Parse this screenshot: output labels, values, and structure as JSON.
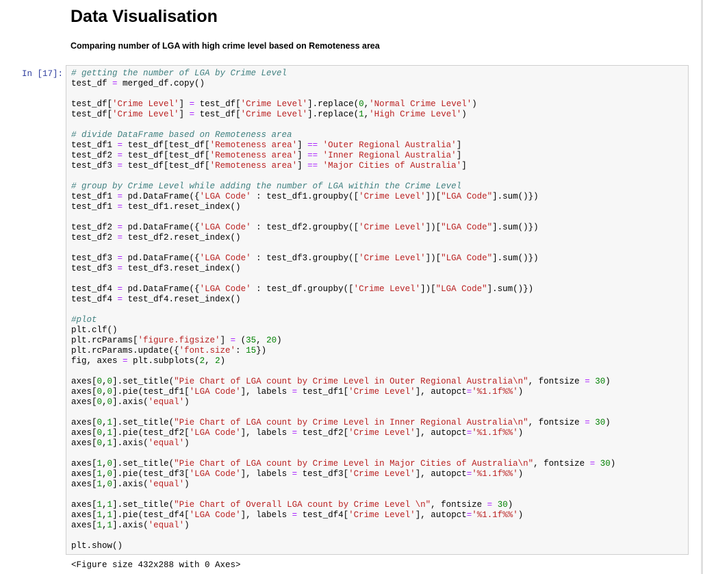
{
  "notebook": {
    "heading": "Data Visualisation",
    "subheading": "Comparing number of LGA with high crime level based on Remoteness area",
    "cell": {
      "prompt": "In [17]:",
      "output": "<Figure size 432x288 with 0 Axes>"
    }
  },
  "code_lines": [
    [
      [
        "cm",
        "# getting the number of LGA by Crime Level"
      ]
    ],
    [
      [
        "",
        "test_df "
      ],
      [
        "op",
        "="
      ],
      [
        "",
        " merged_df.copy()"
      ]
    ],
    [],
    [
      [
        "",
        "test_df["
      ],
      [
        "st",
        "'Crime Level'"
      ],
      [
        "",
        "] "
      ],
      [
        "op",
        "="
      ],
      [
        "",
        " test_df["
      ],
      [
        "st",
        "'Crime Level'"
      ],
      [
        "",
        "].replace("
      ],
      [
        "nu",
        "0"
      ],
      [
        "",
        ","
      ],
      [
        "st",
        "'Normal Crime Level'"
      ],
      [
        "",
        ")"
      ]
    ],
    [
      [
        "",
        "test_df["
      ],
      [
        "st",
        "'Crime Level'"
      ],
      [
        "",
        "] "
      ],
      [
        "op",
        "="
      ],
      [
        "",
        " test_df["
      ],
      [
        "st",
        "'Crime Level'"
      ],
      [
        "",
        "].replace("
      ],
      [
        "nu",
        "1"
      ],
      [
        "",
        ","
      ],
      [
        "st",
        "'High Crime Level'"
      ],
      [
        "",
        ")"
      ]
    ],
    [],
    [
      [
        "cm",
        "# divide DataFrame based on Remoteness area"
      ]
    ],
    [
      [
        "",
        "test_df1 "
      ],
      [
        "op",
        "="
      ],
      [
        "",
        " test_df[test_df["
      ],
      [
        "st",
        "'Remoteness area'"
      ],
      [
        "",
        "] "
      ],
      [
        "op",
        "=="
      ],
      [
        "",
        " "
      ],
      [
        "st",
        "'Outer Regional Australia'"
      ],
      [
        "",
        "]"
      ]
    ],
    [
      [
        "",
        "test_df2 "
      ],
      [
        "op",
        "="
      ],
      [
        "",
        " test_df[test_df["
      ],
      [
        "st",
        "'Remoteness area'"
      ],
      [
        "",
        "] "
      ],
      [
        "op",
        "=="
      ],
      [
        "",
        " "
      ],
      [
        "st",
        "'Inner Regional Australia'"
      ],
      [
        "",
        "]"
      ]
    ],
    [
      [
        "",
        "test_df3 "
      ],
      [
        "op",
        "="
      ],
      [
        "",
        " test_df[test_df["
      ],
      [
        "st",
        "'Remoteness area'"
      ],
      [
        "",
        "] "
      ],
      [
        "op",
        "=="
      ],
      [
        "",
        " "
      ],
      [
        "st",
        "'Major Cities of Australia'"
      ],
      [
        "",
        "]"
      ]
    ],
    [],
    [
      [
        "cm",
        "# group by Crime Level while adding the number of LGA within the Crime Level"
      ]
    ],
    [
      [
        "",
        "test_df1 "
      ],
      [
        "op",
        "="
      ],
      [
        "",
        " pd.DataFrame({"
      ],
      [
        "st",
        "'LGA Code'"
      ],
      [
        "",
        " : test_df1.groupby(["
      ],
      [
        "st",
        "'Crime Level'"
      ],
      [
        "",
        "])["
      ],
      [
        "st",
        "\"LGA Code\""
      ],
      [
        "",
        "].sum()})"
      ]
    ],
    [
      [
        "",
        "test_df1 "
      ],
      [
        "op",
        "="
      ],
      [
        "",
        " test_df1.reset_index()"
      ]
    ],
    [],
    [
      [
        "",
        "test_df2 "
      ],
      [
        "op",
        "="
      ],
      [
        "",
        " pd.DataFrame({"
      ],
      [
        "st",
        "'LGA Code'"
      ],
      [
        "",
        " : test_df2.groupby(["
      ],
      [
        "st",
        "'Crime Level'"
      ],
      [
        "",
        "])["
      ],
      [
        "st",
        "\"LGA Code\""
      ],
      [
        "",
        "].sum()})"
      ]
    ],
    [
      [
        "",
        "test_df2 "
      ],
      [
        "op",
        "="
      ],
      [
        "",
        " test_df2.reset_index()"
      ]
    ],
    [],
    [
      [
        "",
        "test_df3 "
      ],
      [
        "op",
        "="
      ],
      [
        "",
        " pd.DataFrame({"
      ],
      [
        "st",
        "'LGA Code'"
      ],
      [
        "",
        " : test_df3.groupby(["
      ],
      [
        "st",
        "'Crime Level'"
      ],
      [
        "",
        "])["
      ],
      [
        "st",
        "\"LGA Code\""
      ],
      [
        "",
        "].sum()})"
      ]
    ],
    [
      [
        "",
        "test_df3 "
      ],
      [
        "op",
        "="
      ],
      [
        "",
        " test_df3.reset_index()"
      ]
    ],
    [],
    [
      [
        "",
        "test_df4 "
      ],
      [
        "op",
        "="
      ],
      [
        "",
        " pd.DataFrame({"
      ],
      [
        "st",
        "'LGA Code'"
      ],
      [
        "",
        " : test_df.groupby(["
      ],
      [
        "st",
        "'Crime Level'"
      ],
      [
        "",
        "])["
      ],
      [
        "st",
        "\"LGA Code\""
      ],
      [
        "",
        "].sum()})"
      ]
    ],
    [
      [
        "",
        "test_df4 "
      ],
      [
        "op",
        "="
      ],
      [
        "",
        " test_df4.reset_index()"
      ]
    ],
    [],
    [
      [
        "cm",
        "#plot"
      ]
    ],
    [
      [
        "",
        "plt.clf()"
      ]
    ],
    [
      [
        "",
        "plt.rcParams["
      ],
      [
        "st",
        "'figure.figsize'"
      ],
      [
        "",
        "] "
      ],
      [
        "op",
        "="
      ],
      [
        "",
        " ("
      ],
      [
        "nu",
        "35"
      ],
      [
        "",
        ", "
      ],
      [
        "nu",
        "20"
      ],
      [
        "",
        ")"
      ]
    ],
    [
      [
        "",
        "plt.rcParams.update({"
      ],
      [
        "st",
        "'font.size'"
      ],
      [
        "",
        ": "
      ],
      [
        "nu",
        "15"
      ],
      [
        "",
        "})"
      ]
    ],
    [
      [
        "",
        "fig, axes "
      ],
      [
        "op",
        "="
      ],
      [
        "",
        " plt.subplots("
      ],
      [
        "nu",
        "2"
      ],
      [
        "",
        ", "
      ],
      [
        "nu",
        "2"
      ],
      [
        "",
        ")"
      ]
    ],
    [],
    [
      [
        "",
        "axes["
      ],
      [
        "nu",
        "0"
      ],
      [
        "",
        ","
      ],
      [
        "nu",
        "0"
      ],
      [
        "",
        "].set_title("
      ],
      [
        "st",
        "\"Pie Chart of LGA count by Crime Level in Outer Regional Australia\\n\""
      ],
      [
        "",
        ", fontsize "
      ],
      [
        "op",
        "="
      ],
      [
        "",
        " "
      ],
      [
        "nu",
        "30"
      ],
      [
        "",
        ")"
      ]
    ],
    [
      [
        "",
        "axes["
      ],
      [
        "nu",
        "0"
      ],
      [
        "",
        ","
      ],
      [
        "nu",
        "0"
      ],
      [
        "",
        "].pie(test_df1["
      ],
      [
        "st",
        "'LGA Code'"
      ],
      [
        "",
        "], labels "
      ],
      [
        "op",
        "="
      ],
      [
        "",
        " test_df1["
      ],
      [
        "st",
        "'Crime Level'"
      ],
      [
        "",
        "], autopct"
      ],
      [
        "op",
        "="
      ],
      [
        "st",
        "'%1.1f%%'"
      ],
      [
        "",
        ")"
      ]
    ],
    [
      [
        "",
        "axes["
      ],
      [
        "nu",
        "0"
      ],
      [
        "",
        ","
      ],
      [
        "nu",
        "0"
      ],
      [
        "",
        "].axis("
      ],
      [
        "st",
        "'equal'"
      ],
      [
        "",
        ")"
      ]
    ],
    [],
    [
      [
        "",
        "axes["
      ],
      [
        "nu",
        "0"
      ],
      [
        "",
        ","
      ],
      [
        "nu",
        "1"
      ],
      [
        "",
        "].set_title("
      ],
      [
        "st",
        "\"Pie Chart of LGA count by Crime Level in Inner Regional Australia\\n\""
      ],
      [
        "",
        ", fontsize "
      ],
      [
        "op",
        "="
      ],
      [
        "",
        " "
      ],
      [
        "nu",
        "30"
      ],
      [
        "",
        ")"
      ]
    ],
    [
      [
        "",
        "axes["
      ],
      [
        "nu",
        "0"
      ],
      [
        "",
        ","
      ],
      [
        "nu",
        "1"
      ],
      [
        "",
        "].pie(test_df2["
      ],
      [
        "st",
        "'LGA Code'"
      ],
      [
        "",
        "], labels "
      ],
      [
        "op",
        "="
      ],
      [
        "",
        " test_df2["
      ],
      [
        "st",
        "'Crime Level'"
      ],
      [
        "",
        "], autopct"
      ],
      [
        "op",
        "="
      ],
      [
        "st",
        "'%1.1f%%'"
      ],
      [
        "",
        ")"
      ]
    ],
    [
      [
        "",
        "axes["
      ],
      [
        "nu",
        "0"
      ],
      [
        "",
        ","
      ],
      [
        "nu",
        "1"
      ],
      [
        "",
        "].axis("
      ],
      [
        "st",
        "'equal'"
      ],
      [
        "",
        ")"
      ]
    ],
    [],
    [
      [
        "",
        "axes["
      ],
      [
        "nu",
        "1"
      ],
      [
        "",
        ","
      ],
      [
        "nu",
        "0"
      ],
      [
        "",
        "].set_title("
      ],
      [
        "st",
        "\"Pie Chart of LGA count by Crime Level in Major Cities of Australia\\n\""
      ],
      [
        "",
        ", fontsize "
      ],
      [
        "op",
        "="
      ],
      [
        "",
        " "
      ],
      [
        "nu",
        "30"
      ],
      [
        "",
        ")"
      ]
    ],
    [
      [
        "",
        "axes["
      ],
      [
        "nu",
        "1"
      ],
      [
        "",
        ","
      ],
      [
        "nu",
        "0"
      ],
      [
        "",
        "].pie(test_df3["
      ],
      [
        "st",
        "'LGA Code'"
      ],
      [
        "",
        "], labels "
      ],
      [
        "op",
        "="
      ],
      [
        "",
        " test_df3["
      ],
      [
        "st",
        "'Crime Level'"
      ],
      [
        "",
        "], autopct"
      ],
      [
        "op",
        "="
      ],
      [
        "st",
        "'%1.1f%%'"
      ],
      [
        "",
        ")"
      ]
    ],
    [
      [
        "",
        "axes["
      ],
      [
        "nu",
        "1"
      ],
      [
        "",
        ","
      ],
      [
        "nu",
        "0"
      ],
      [
        "",
        "].axis("
      ],
      [
        "st",
        "'equal'"
      ],
      [
        "",
        ")"
      ]
    ],
    [],
    [
      [
        "",
        "axes["
      ],
      [
        "nu",
        "1"
      ],
      [
        "",
        ","
      ],
      [
        "nu",
        "1"
      ],
      [
        "",
        "].set_title("
      ],
      [
        "st",
        "\"Pie Chart of Overall LGA count by Crime Level \\n\""
      ],
      [
        "",
        ", fontsize "
      ],
      [
        "op",
        "="
      ],
      [
        "",
        " "
      ],
      [
        "nu",
        "30"
      ],
      [
        "",
        ")"
      ]
    ],
    [
      [
        "",
        "axes["
      ],
      [
        "nu",
        "1"
      ],
      [
        "",
        ","
      ],
      [
        "nu",
        "1"
      ],
      [
        "",
        "].pie(test_df4["
      ],
      [
        "st",
        "'LGA Code'"
      ],
      [
        "",
        "], labels "
      ],
      [
        "op",
        "="
      ],
      [
        "",
        " test_df4["
      ],
      [
        "st",
        "'Crime Level'"
      ],
      [
        "",
        "], autopct"
      ],
      [
        "op",
        "="
      ],
      [
        "st",
        "'%1.1f%%'"
      ],
      [
        "",
        ")"
      ]
    ],
    [
      [
        "",
        "axes["
      ],
      [
        "nu",
        "1"
      ],
      [
        "",
        ","
      ],
      [
        "nu",
        "1"
      ],
      [
        "",
        "].axis("
      ],
      [
        "st",
        "'equal'"
      ],
      [
        "",
        ")"
      ]
    ],
    [],
    [
      [
        "",
        "plt.show()"
      ]
    ]
  ]
}
